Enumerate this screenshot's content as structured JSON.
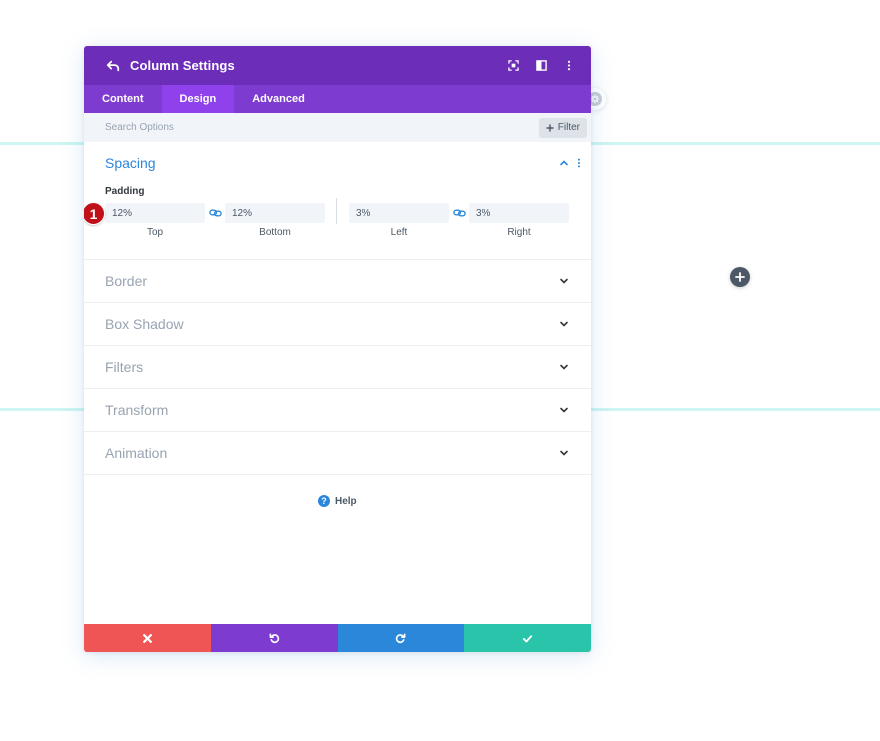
{
  "modal": {
    "title": "Column Settings"
  },
  "tabs": [
    {
      "label": "Content"
    },
    {
      "label": "Design"
    },
    {
      "label": "Advanced"
    }
  ],
  "search": {
    "placeholder": "Search Options",
    "filter_label": "Filter"
  },
  "spacing": {
    "title": "Spacing",
    "padding_label": "Padding",
    "step_badge": "1",
    "fields": {
      "top": {
        "value": "12%",
        "caption": "Top"
      },
      "bottom": {
        "value": "12%",
        "caption": "Bottom"
      },
      "left": {
        "value": "3%",
        "caption": "Left"
      },
      "right": {
        "value": "3%",
        "caption": "Right"
      }
    }
  },
  "sections": [
    {
      "label": "Border"
    },
    {
      "label": "Box Shadow"
    },
    {
      "label": "Filters"
    },
    {
      "label": "Transform"
    },
    {
      "label": "Animation"
    }
  ],
  "help": {
    "label": "Help",
    "glyph": "?"
  },
  "colors": {
    "header": "#6c2eb9",
    "tabs": "#7e3bd0",
    "active_tab": "#8f42ec",
    "accent": "#2b87da",
    "cancel": "#ef5555",
    "undo": "#7e3bd0",
    "redo": "#2b87da",
    "save": "#29c4a9",
    "badge": "#c0101a"
  },
  "icons": {
    "back": "undo-arrow-icon",
    "fullscreen": "fullscreen-icon",
    "split": "split-view-icon",
    "more": "more-vertical-icon",
    "cancel": "close-icon",
    "undo": "undo-icon",
    "redo": "redo-icon",
    "save": "check-icon",
    "add": "plus-icon",
    "link": "link-icon"
  }
}
